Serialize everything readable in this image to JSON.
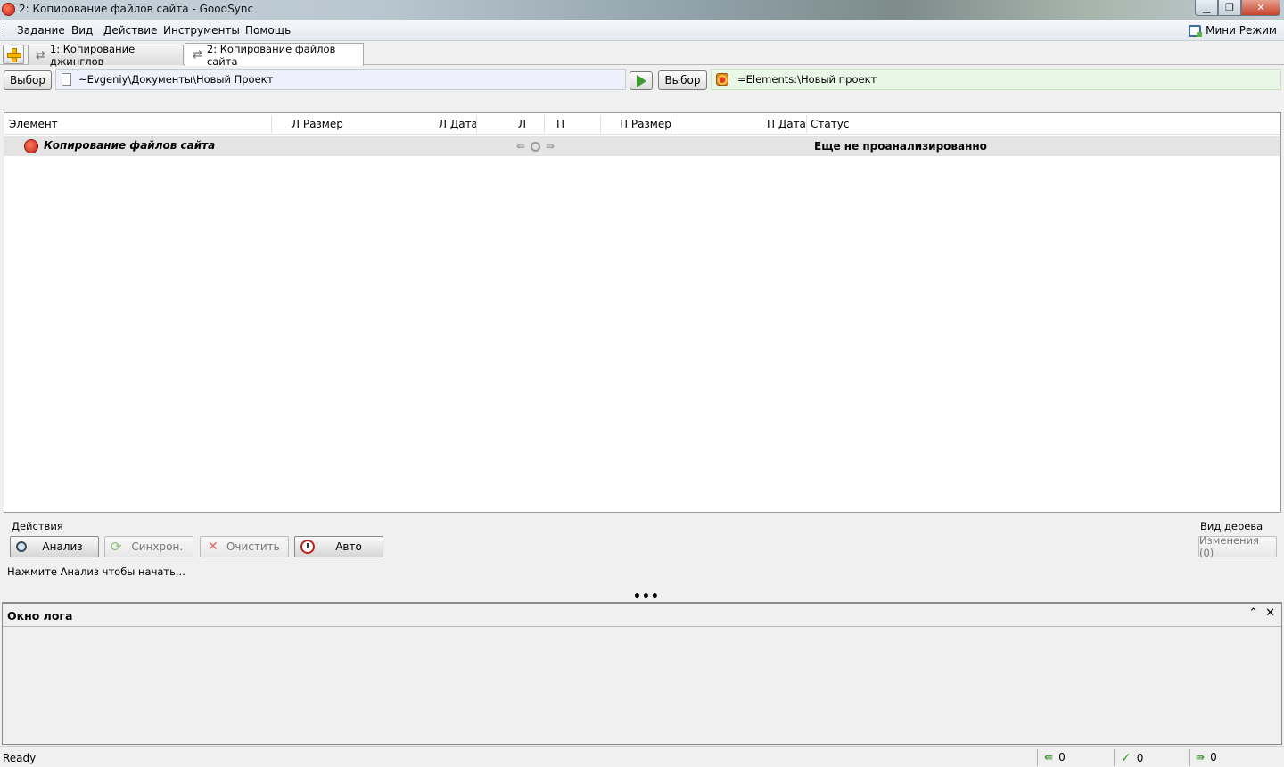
{
  "window": {
    "title": "2: Копирование файлов сайта - GoodSync"
  },
  "menu": {
    "items": [
      "Задание",
      "Вид",
      "Действие",
      "Инструменты",
      "Помощь"
    ],
    "mini_mode": "Мини Режим"
  },
  "tabs": [
    {
      "label": "1: Копирование джинглов",
      "active": false
    },
    {
      "label": "2: Копирование файлов сайта",
      "active": true
    }
  ],
  "paths": {
    "left_button": "Выбор",
    "left_path": "~Evgeniy\\Документы\\Новый Проект",
    "right_button": "Выбор",
    "right_path": "=Elements:\\Новый проект"
  },
  "table": {
    "columns": [
      "Элемент",
      "Л Размер",
      "Л Дата",
      "Л",
      "П",
      "П Размер",
      "П Дата",
      "Статус"
    ],
    "rows": [
      {
        "element": "Копирование файлов сайта",
        "status": "Еще не проанализированно"
      }
    ]
  },
  "actions": {
    "group_label": "Действия",
    "analyze": "Анализ",
    "sync": "Синхрон.",
    "clear": "Очистить",
    "auto": "Авто",
    "hint": "Нажмите Анализ чтобы начать..."
  },
  "tree_view": {
    "label": "Вид дерева",
    "changes_button": "Изменения (0)"
  },
  "log": {
    "title": "Окно лога"
  },
  "status_bar": {
    "text": "Ready",
    "left_count": "0",
    "ok_count": "0",
    "right_count": "0"
  },
  "colors": {
    "left_path_bg": "#eef0fb",
    "right_path_bg": "#e9f7e6",
    "job_row_bg": "#e4e4e4"
  }
}
